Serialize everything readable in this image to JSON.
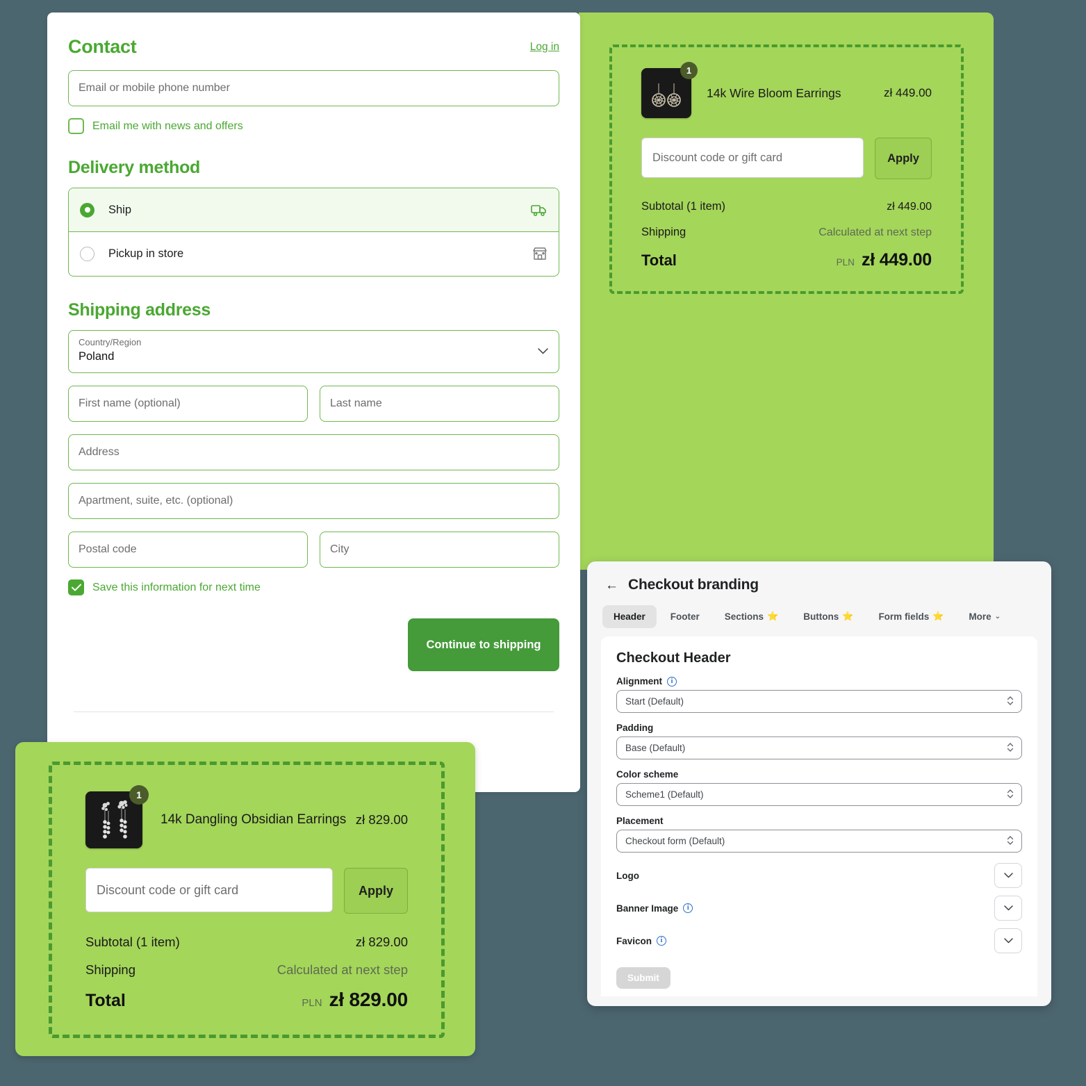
{
  "colors": {
    "page_background": "#4c6670",
    "brand_green": "#4aa832",
    "panel_green": "#a4d65a",
    "dashed_border_green": "#4a9a2f",
    "button_green": "#459a3a",
    "info_blue": "#2c6ecb"
  },
  "checkout": {
    "contact": {
      "title": "Contact",
      "login_label": "Log in",
      "email_placeholder": "Email or mobile phone number",
      "newsletter_label": "Email me with news and offers",
      "newsletter_checked": false
    },
    "delivery": {
      "title": "Delivery method",
      "options": [
        {
          "label": "Ship",
          "icon": "truck-icon",
          "selected": true
        },
        {
          "label": "Pickup in store",
          "icon": "storefront-icon",
          "selected": false
        }
      ]
    },
    "shipping_address": {
      "title": "Shipping address",
      "country": {
        "caption": "Country/Region",
        "value": "Poland"
      },
      "first_name_placeholder": "First name (optional)",
      "last_name_placeholder": "Last name",
      "address_placeholder": "Address",
      "apartment_placeholder": "Apartment, suite, etc. (optional)",
      "postal_code_placeholder": "Postal code",
      "city_placeholder": "City",
      "save_info_label": "Save this information for next time",
      "save_info_checked": true
    },
    "continue_button": "Continue to shipping"
  },
  "summary_top": {
    "item": {
      "name": "14k Wire Bloom Earrings",
      "price": "zł 449.00",
      "quantity": "1",
      "thumbnail": "wire-bloom-earrings-image"
    },
    "discount_placeholder": "Discount code or gift card",
    "apply_label": "Apply",
    "subtotal_label": "Subtotal (1 item)",
    "subtotal_value": "zł 449.00",
    "shipping_label": "Shipping",
    "shipping_value": "Calculated at next step",
    "total_label": "Total",
    "currency": "PLN",
    "total_value": "zł 449.00"
  },
  "summary_bottom": {
    "item": {
      "name": "14k Dangling Obsidian Earrings",
      "price": "zł 829.00",
      "quantity": "1",
      "thumbnail": "dangling-obsidian-earrings-image"
    },
    "discount_placeholder": "Discount code or gift card",
    "apply_label": "Apply",
    "subtotal_label": "Subtotal (1 item)",
    "subtotal_value": "zł 829.00",
    "shipping_label": "Shipping",
    "shipping_value": "Calculated at next step",
    "total_label": "Total",
    "currency": "PLN",
    "total_value": "zł 829.00"
  },
  "branding": {
    "title": "Checkout branding",
    "back_icon": "back-arrow-icon",
    "tabs": [
      {
        "label": "Header",
        "star": "",
        "active": true
      },
      {
        "label": "Footer",
        "star": "",
        "active": false
      },
      {
        "label": "Sections",
        "star": "⭐",
        "active": false
      },
      {
        "label": "Buttons",
        "star": "⭐",
        "active": false
      },
      {
        "label": "Form fields",
        "star": "⭐",
        "active": false
      },
      {
        "label": "More",
        "star": "",
        "active": false,
        "chevron": "⌄"
      }
    ],
    "panel_heading": "Checkout Header",
    "fields": [
      {
        "label": "Alignment",
        "info": true,
        "value": "Start (Default)"
      },
      {
        "label": "Padding",
        "info": false,
        "value": "Base (Default)"
      },
      {
        "label": "Color scheme",
        "info": false,
        "value": "Scheme1 (Default)"
      },
      {
        "label": "Placement",
        "info": false,
        "value": "Checkout form (Default)"
      }
    ],
    "collapsibles": [
      {
        "label": "Logo",
        "info": false
      },
      {
        "label": "Banner Image",
        "info": true
      },
      {
        "label": "Favicon",
        "info": true
      }
    ],
    "submit_label": "Submit"
  }
}
